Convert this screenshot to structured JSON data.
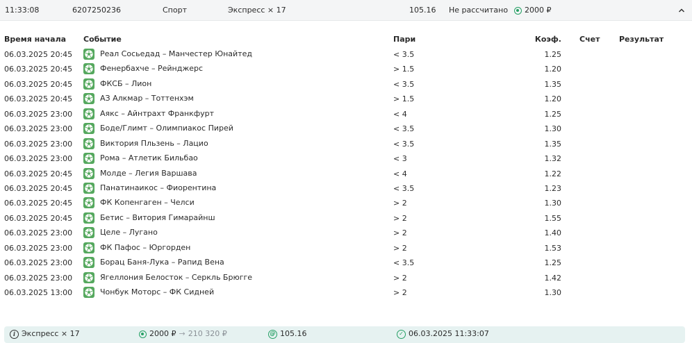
{
  "top_bar": {
    "time": "11:33:08",
    "id": "6207250236",
    "sport": "Спорт",
    "bet_type": "Экспресс × 17",
    "coefficient": "105.16",
    "status": "Не рассчитано",
    "stake": "2000 ₽"
  },
  "table": {
    "headers": {
      "time": "Время начала",
      "event": "Событие",
      "bet": "Пари",
      "coef": "Коэф.",
      "score": "Счет",
      "result": "Результат"
    },
    "rows": [
      {
        "time": "06.03.2025 20:45",
        "event": "Реал Сосьедад – Манчестер Юнайтед",
        "bet": "< 3.5",
        "coef": "1.25"
      },
      {
        "time": "06.03.2025 20:45",
        "event": "Фенербахче – Рейнджерс",
        "bet": "> 1.5",
        "coef": "1.20"
      },
      {
        "time": "06.03.2025 20:45",
        "event": "ФКСБ – Лион",
        "bet": "< 3.5",
        "coef": "1.35"
      },
      {
        "time": "06.03.2025 20:45",
        "event": "АЗ Алкмар – Тоттенхэм",
        "bet": "> 1.5",
        "coef": "1.20"
      },
      {
        "time": "06.03.2025 23:00",
        "event": "Аякс – Айнтрахт Франкфурт",
        "bet": "< 4",
        "coef": "1.25"
      },
      {
        "time": "06.03.2025 23:00",
        "event": "Боде/Глимт – Олимпиакос Пирей",
        "bet": "< 3.5",
        "coef": "1.30"
      },
      {
        "time": "06.03.2025 23:00",
        "event": "Виктория Пльзень – Лацио",
        "bet": "< 3.5",
        "coef": "1.35"
      },
      {
        "time": "06.03.2025 23:00",
        "event": "Рома – Атлетик Бильбао",
        "bet": "< 3",
        "coef": "1.32"
      },
      {
        "time": "06.03.2025 20:45",
        "event": "Молде – Легия Варшава",
        "bet": "< 4",
        "coef": "1.22"
      },
      {
        "time": "06.03.2025 20:45",
        "event": "Панатинаикос – Фиорентина",
        "bet": "< 3.5",
        "coef": "1.23"
      },
      {
        "time": "06.03.2025 20:45",
        "event": "ФК Копенгаген – Челси",
        "bet": "> 2",
        "coef": "1.30"
      },
      {
        "time": "06.03.2025 20:45",
        "event": "Бетис – Витория Гимарайнш",
        "bet": "> 2",
        "coef": "1.55"
      },
      {
        "time": "06.03.2025 23:00",
        "event": "Целе – Лугано",
        "bet": "> 2",
        "coef": "1.40"
      },
      {
        "time": "06.03.2025 23:00",
        "event": "ФК Пафос – Юргорден",
        "bet": "> 2",
        "coef": "1.53"
      },
      {
        "time": "06.03.2025 23:00",
        "event": "Борац Баня-Лука – Рапид Вена",
        "bet": "< 3.5",
        "coef": "1.25"
      },
      {
        "time": "06.03.2025 23:00",
        "event": "Ягеллония Белосток – Серкль Брюгге",
        "bet": "> 2",
        "coef": "1.42"
      },
      {
        "time": "06.03.2025 13:00",
        "event": "Чонбук Моторс – ФК Сидней",
        "bet": "> 2",
        "coef": "1.30"
      }
    ]
  },
  "footer": {
    "bet_type": "Экспресс × 17",
    "stake": "2000 ₽",
    "arrow": "→",
    "payout": "210 320 ₽",
    "coefficient": "105.16",
    "datetime": "06.03.2025 11:33:07"
  },
  "icons": {
    "row_icon": "soccer-ball-icon",
    "stake_icon": "coin-icon",
    "chevron": "chevron-up-icon",
    "info": "info-icon",
    "coef": "coefficient-icon",
    "date": "calendar-icon"
  },
  "colors": {
    "accent": "#26a065",
    "sport_icon_bg": "#55a85e",
    "footer_bg": "#e6f2f1",
    "top_bar_bg": "#f4f5f6"
  }
}
